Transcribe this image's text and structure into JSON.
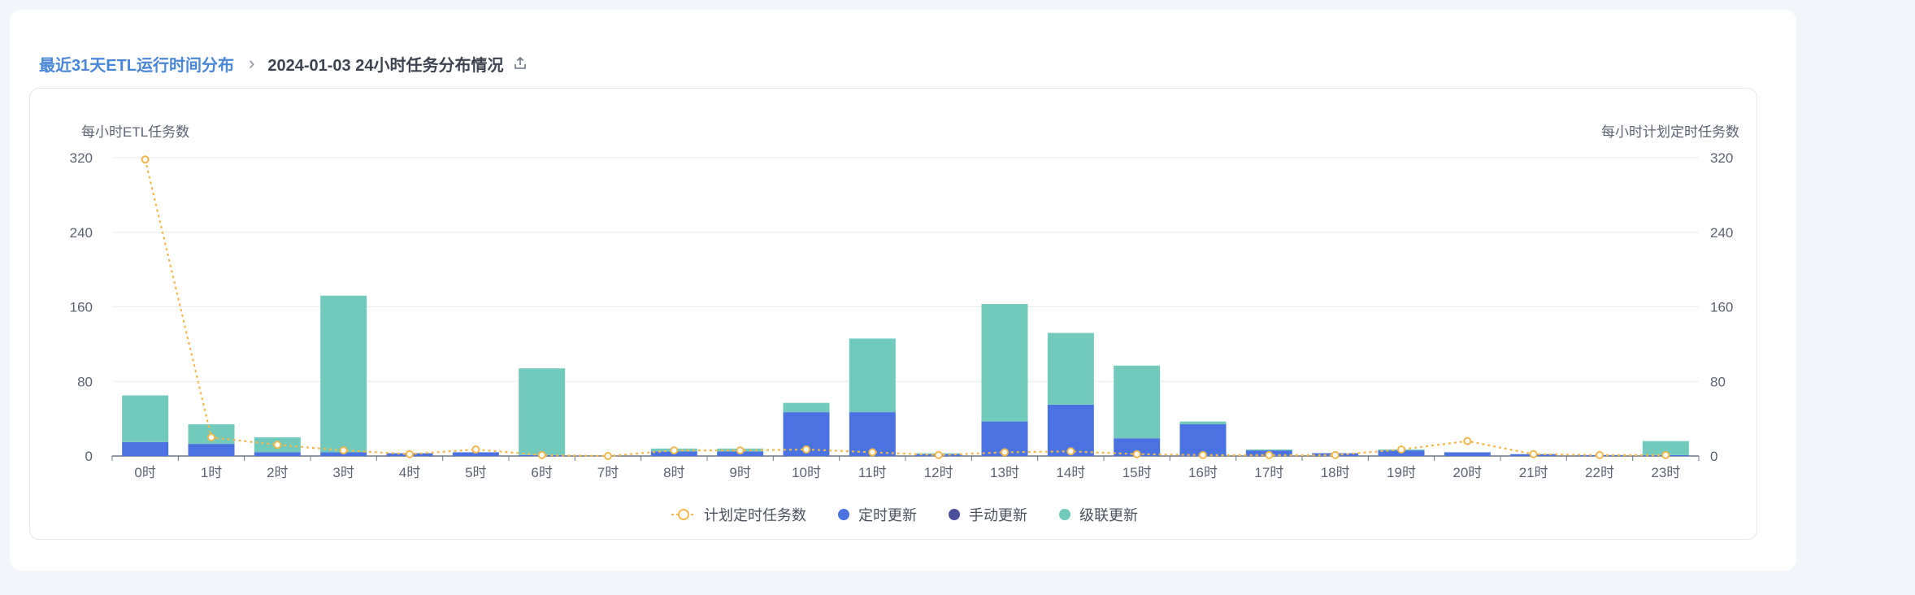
{
  "breadcrumb": {
    "parent": "最近31天ETL运行时间分布",
    "current": "2024-01-03 24小时任务分布情况",
    "export_icon": "export-icon"
  },
  "colors": {
    "scheduled": "#4a72e0",
    "manual": "#4a4f9c",
    "cascade": "#72cabd",
    "plan_line": "#f2b84d",
    "grid": "#e8ebf0",
    "link": "#4a86d8"
  },
  "chart_data": {
    "type": "bar",
    "stacked": true,
    "left_axis_title": "每小时ETL任务数",
    "right_axis_title": "每小时计划定时任务数",
    "ylim": [
      0,
      320
    ],
    "yticks": [
      "0",
      "80",
      "160",
      "240",
      "320"
    ],
    "categories": [
      "0时",
      "1时",
      "2时",
      "3时",
      "4时",
      "5时",
      "6时",
      "7时",
      "8时",
      "9时",
      "10时",
      "11时",
      "12时",
      "13时",
      "14时",
      "15时",
      "16时",
      "17时",
      "18时",
      "19时",
      "20时",
      "21时",
      "22时",
      "23时"
    ],
    "series": [
      {
        "name": "定时更新",
        "type": "bar",
        "values": [
          15,
          13,
          4,
          4,
          3,
          4,
          1,
          0,
          5,
          5,
          47,
          47,
          2,
          37,
          55,
          19,
          34,
          6,
          3,
          6,
          4,
          2,
          1,
          1
        ]
      },
      {
        "name": "手动更新",
        "type": "bar",
        "values": [
          0,
          0,
          0,
          0,
          0,
          0,
          0,
          0,
          0,
          0,
          0,
          0,
          0,
          0,
          0,
          0,
          0,
          0,
          0,
          0,
          0,
          0,
          0,
          0
        ]
      },
      {
        "name": "级联更新",
        "type": "bar",
        "values": [
          50,
          21,
          16,
          168,
          0,
          0,
          93,
          0,
          3,
          3,
          10,
          79,
          1,
          126,
          77,
          78,
          3,
          1,
          0,
          1,
          0,
          0,
          0,
          15
        ]
      },
      {
        "name": "计划定时任务数",
        "type": "line",
        "values": [
          318,
          20,
          12,
          6,
          2,
          7,
          1,
          0,
          6,
          6,
          7,
          4,
          1,
          4,
          5,
          2,
          1,
          1,
          1,
          7,
          16,
          2,
          1,
          1
        ]
      }
    ],
    "legend_position": "bottom"
  }
}
